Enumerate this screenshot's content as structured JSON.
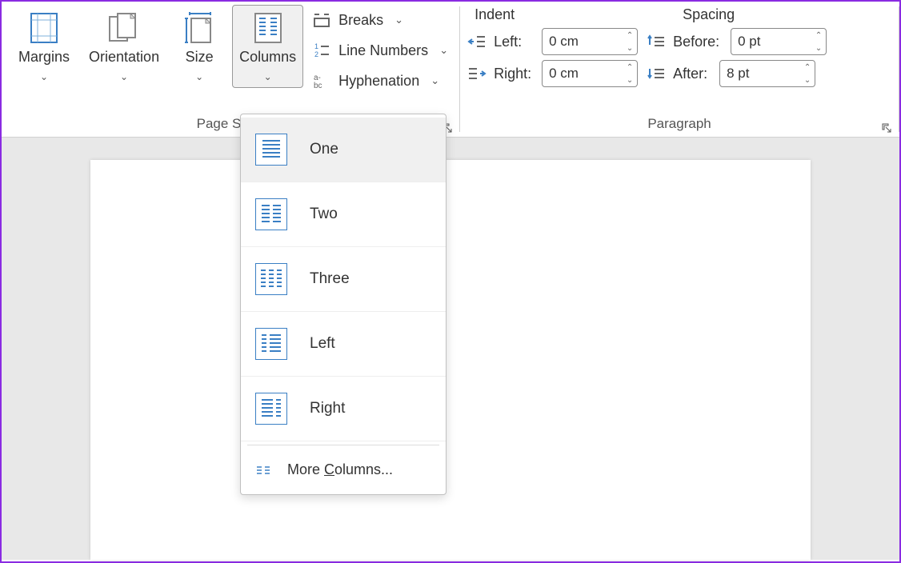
{
  "ribbon": {
    "page_setup": {
      "label": "Page Setup",
      "margins": "Margins",
      "orientation": "Orientation",
      "size": "Size",
      "columns": "Columns",
      "breaks": "Breaks",
      "line_numbers": "Line Numbers",
      "hyphenation": "Hyphenation"
    },
    "paragraph": {
      "label": "Paragraph",
      "indent_heading": "Indent",
      "spacing_heading": "Spacing",
      "left_label": "Left:",
      "right_label": "Right:",
      "before_label": "Before:",
      "after_label": "After:",
      "left_value": "0 cm",
      "right_value": "0 cm",
      "before_value": "0 pt",
      "after_value": "8 pt"
    }
  },
  "columns_menu": {
    "one": "One",
    "two": "Two",
    "three": "Three",
    "left": "Left",
    "right": "Right",
    "more_prefix": "More ",
    "more_c": "C",
    "more_suffix": "olumns..."
  }
}
